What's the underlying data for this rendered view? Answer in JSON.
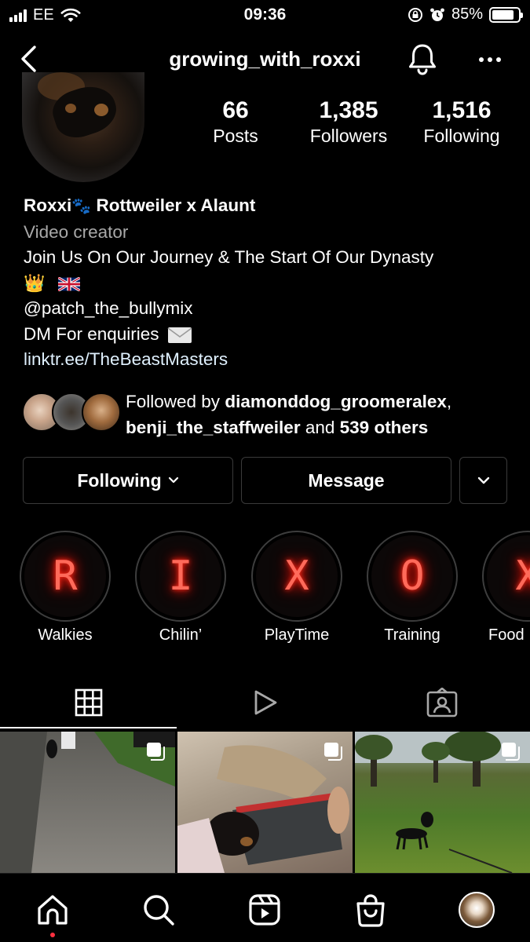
{
  "status_bar": {
    "carrier": "EE",
    "time": "09:36",
    "battery_percent": "85%",
    "battery_level": 0.85
  },
  "header": {
    "username": "growing_with_roxxi"
  },
  "profile": {
    "stats": [
      {
        "value": "66",
        "label": "Posts"
      },
      {
        "value": "1,385",
        "label": "Followers"
      },
      {
        "value": "1,516",
        "label": "Following"
      }
    ],
    "name": "Roxxi",
    "name_suffix": "Rottweiler x Alaunt",
    "category": "Video creator",
    "bio_line1": "Join Us On Our Journey & The Start Of Our Dynasty",
    "mention": "@patch_the_bullymix",
    "dm_text": "DM For enquiries",
    "link": "linktr.ee/TheBeastMasters"
  },
  "followed_by": {
    "prefix": "Followed by",
    "user1": "diamonddog_groomeralex",
    "user2": "benji_the_staffweiler",
    "conj": "and",
    "others": "539 others"
  },
  "actions": {
    "following_label": "Following",
    "message_label": "Message"
  },
  "highlights": [
    {
      "letter": "R",
      "label": "Walkies"
    },
    {
      "letter": "I",
      "label": "Chilin’"
    },
    {
      "letter": "X",
      "label": "PlayTime"
    },
    {
      "letter": "O",
      "label": "Training"
    },
    {
      "letter": "X",
      "label": "Food"
    }
  ],
  "tabs": [
    "grid-icon",
    "reels-play-icon",
    "tagged-icon"
  ],
  "icons": {
    "back": "chevron-left-icon",
    "notifications": "bell-icon",
    "more": "more-horizontal-icon",
    "nav": [
      "home-icon",
      "search-icon",
      "reels-icon",
      "shop-icon",
      "profile-avatar"
    ]
  },
  "colors": {
    "background": "#000000",
    "secondary_text": "#a8a8a8",
    "link": "#e0f1ff",
    "highlight_glow": "#ff2a1a",
    "notification_dot": "#ff3040"
  }
}
